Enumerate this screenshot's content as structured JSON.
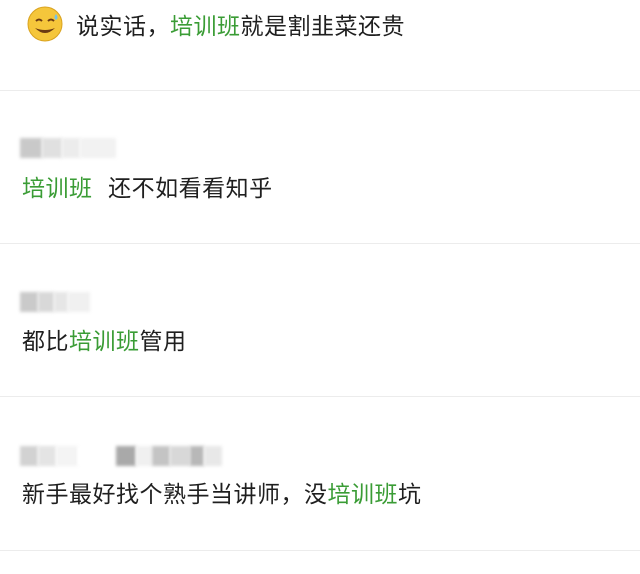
{
  "comments": [
    {
      "emoji": "grinning-sweat-face-icon",
      "segments": [
        {
          "text": "说实话，",
          "highlight": false
        },
        {
          "text": "培训班",
          "highlight": true
        },
        {
          "text": "就是割韭菜还贵",
          "highlight": false
        }
      ]
    },
    {
      "segments": [
        {
          "text": "培训班",
          "highlight": true
        },
        {
          "text": "  还不如看看知乎",
          "highlight": false
        }
      ]
    },
    {
      "segments": [
        {
          "text": "都比",
          "highlight": false
        },
        {
          "text": "培训班",
          "highlight": true
        },
        {
          "text": "管用",
          "highlight": false
        }
      ]
    },
    {
      "segments": [
        {
          "text": "新手最好找个熟手当讲师，没",
          "highlight": false
        },
        {
          "text": "培训班",
          "highlight": true
        },
        {
          "text": "坑",
          "highlight": false
        }
      ]
    }
  ],
  "colors": {
    "highlight": "#3a9c35",
    "text": "#1f1f1f",
    "divider": "#ececec",
    "blur_name": "#cfcfcf"
  }
}
